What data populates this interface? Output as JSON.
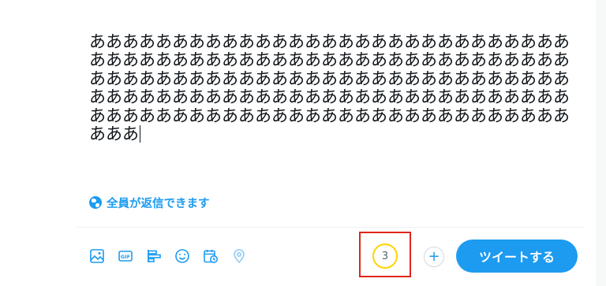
{
  "compose": {
    "text": "ああああああああああああああああああああああああああああああああああああああああああああああああああああああああああああああああああああああああああああああああああああああああああああああああああああああああああああああああああああああああああああああああああああああああああああああああああああ"
  },
  "reply_setting": {
    "label": "全員が返信できます",
    "icon": "globe-icon"
  },
  "toolbar": {
    "icons": [
      "image-icon",
      "gif-icon",
      "poll-icon",
      "emoji-icon",
      "schedule-icon",
      "location-icon"
    ],
    "gif_label": "GIF"
  },
  "counter": {
    "remaining": "3",
    "ring_color": "#ffd400",
    "highlight_color": "#e1251b"
  },
  "add_button": {
    "label": "+"
  },
  "tweet_button": {
    "label": "ツイートする",
    "color": "#1d9bf0"
  }
}
